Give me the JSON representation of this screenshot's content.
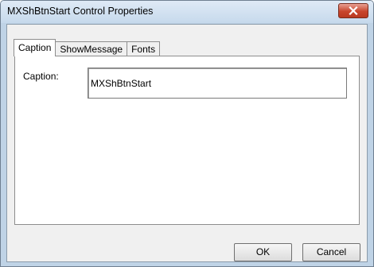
{
  "window": {
    "title": "MXShBtnStart Control Properties",
    "close_icon": "close-icon"
  },
  "tabs": [
    {
      "label": "Caption",
      "active": true
    },
    {
      "label": "ShowMessage",
      "active": false
    },
    {
      "label": "Fonts",
      "active": false
    }
  ],
  "caption_panel": {
    "label": "Caption:",
    "value": "MXShBtnStart"
  },
  "buttons": {
    "ok_label": "OK",
    "cancel_label": "Cancel"
  },
  "colors": {
    "frame": "#bfd3e6",
    "close_button": "#c8452c",
    "client": "#f0f0f0"
  }
}
